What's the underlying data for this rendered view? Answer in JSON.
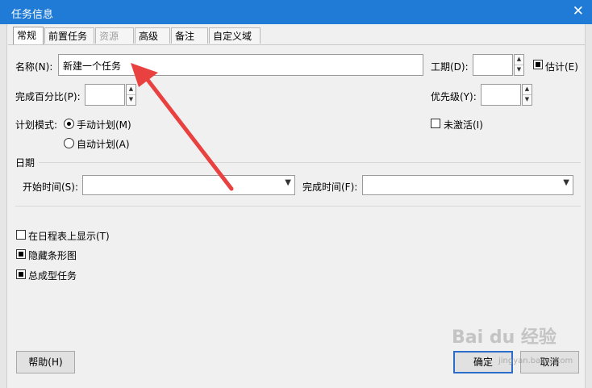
{
  "window": {
    "title": "任务信息",
    "close_glyph": "✕"
  },
  "tabs": [
    {
      "label": "常规",
      "active": true
    },
    {
      "label": "前置任务"
    },
    {
      "label": "资源",
      "disabled": true
    },
    {
      "label": "高级"
    },
    {
      "label": "备注"
    },
    {
      "label": "自定义域"
    }
  ],
  "general": {
    "name_label": "名称(N):",
    "name_value": "新建一个任务",
    "duration_label": "工期(D):",
    "duration_value": "",
    "estimated_label": "估计(E)",
    "estimated_checked": true,
    "percent_label": "完成百分比(P):",
    "percent_value": "",
    "priority_label": "优先级(Y):",
    "priority_value": "",
    "schedule_mode_label": "计划模式:",
    "manual_label": "手动计划(M)",
    "manual_selected": true,
    "auto_label": "自动计划(A)",
    "inactive_label": "未激活(I)",
    "inactive_checked": false,
    "dates_section_label": "日期",
    "start_label": "开始时间(S):",
    "start_value": "",
    "finish_label": "完成时间(F):",
    "finish_value": "",
    "show_timeline_label": "在日程表上显示(T)",
    "show_timeline_checked": false,
    "hide_bar_label": "隐藏条形图",
    "hide_bar_checked": true,
    "summary_label": "总成型任务",
    "summary_checked": true
  },
  "buttons": {
    "help": "帮助(H)",
    "ok": "确定",
    "cancel": "取消"
  },
  "watermark": {
    "text": "Bai du 经验",
    "sub": "jingyan.baidu.com"
  },
  "colors": {
    "titlebar": "#1f7bd6",
    "arrow": "#e8413f",
    "default_button_border": "#2a6ec9"
  }
}
